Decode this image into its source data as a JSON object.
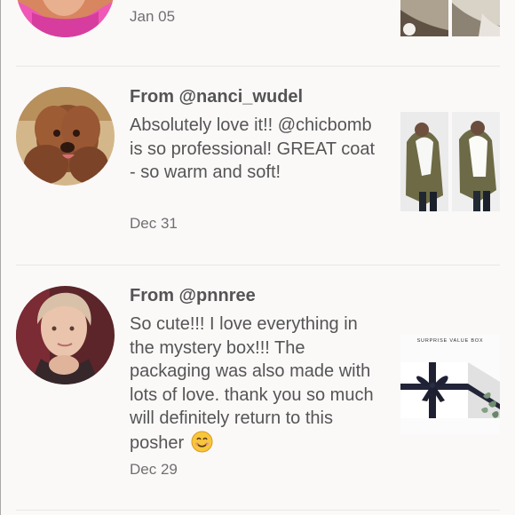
{
  "reviews": [
    {
      "date": "Jan 05",
      "avatar_icon": "user-avatar-icon",
      "thumbnail_icon": "product-thumbnail-icon"
    },
    {
      "author": "From @nanci_wudel",
      "message": "Absolutely love it!! @chicbomb is so professional! GREAT coat - so warm and soft!",
      "date": "Dec 31",
      "avatar_icon": "dog-avatar-icon",
      "thumbnail_icon": "coat-thumbnail-icon"
    },
    {
      "author": "From @pnnree",
      "message": "So cute!!! I love everything in the mystery box!!! The packaging was also made with lots of love. thank you so much will definitely return to this posher",
      "emoji": "smile-emoji",
      "date": "Dec 29",
      "avatar_icon": "user-avatar-icon",
      "thumbnail_icon": "gift-box-thumbnail-icon",
      "thumbnail_caption": "SURPRISE VALUE BOX"
    }
  ],
  "colors": {
    "background": "#fbf8f8",
    "text": "#555555",
    "date": "#707070",
    "divider": "#e8e6e6",
    "accent": "#000000"
  }
}
